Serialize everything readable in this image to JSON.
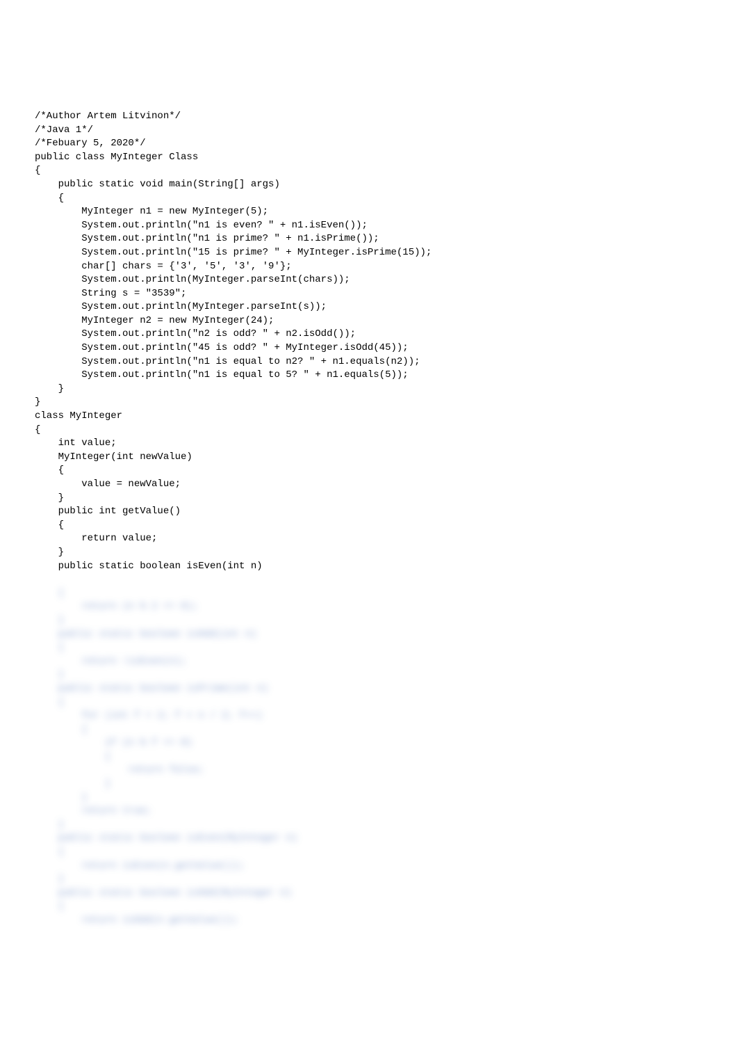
{
  "code": {
    "visible_lines": [
      "/*Author Artem Litvinon*/",
      "/*Java 1*/",
      "/*Febuary 5, 2020*/",
      "public class MyInteger Class",
      "{",
      "    public static void main(String[] args)",
      "    {",
      "        MyInteger n1 = new MyInteger(5);",
      "        System.out.println(\"n1 is even? \" + n1.isEven());",
      "        System.out.println(\"n1 is prime? \" + n1.isPrime());",
      "        System.out.println(\"15 is prime? \" + MyInteger.isPrime(15));",
      "        char[] chars = {'3', '5', '3', '9'};",
      "        System.out.println(MyInteger.parseInt(chars));",
      "        String s = \"3539\";",
      "        System.out.println(MyInteger.parseInt(s));",
      "        MyInteger n2 = new MyInteger(24);",
      "        System.out.println(\"n2 is odd? \" + n2.isOdd());",
      "        System.out.println(\"45 is odd? \" + MyInteger.isOdd(45));",
      "        System.out.println(\"n1 is equal to n2? \" + n1.equals(n2));",
      "        System.out.println(\"n1 is equal to 5? \" + n1.equals(5));",
      "    }",
      "}",
      "class MyInteger",
      "{",
      "    int value;",
      "    MyInteger(int newValue)",
      "    {",
      "        value = newValue;",
      "    }",
      "    public int getValue()",
      "    {",
      "        return value;",
      "    }",
      "    public static boolean isEven(int n)"
    ],
    "blurred_lines": [
      "    {",
      "        return (n % 2 == 0);",
      "    }",
      "    public static boolean isOdd(int n)",
      "    {",
      "        return !isEven(n);",
      "    }",
      "    public static boolean isPrime(int n)",
      "    {",
      "        for (int f = 2; f < n / 2; f++)",
      "        {",
      "            if (n % f == 0)",
      "            {",
      "                return false;",
      "            }",
      "        }",
      "        return true;",
      "    }",
      "    public static boolean isEven(MyInteger n)",
      "    {",
      "        return isEven(n.getValue());",
      "    }",
      "    public static boolean isOdd(MyInteger n)",
      "    {",
      "        return isOdd(n.getValue());"
    ]
  }
}
